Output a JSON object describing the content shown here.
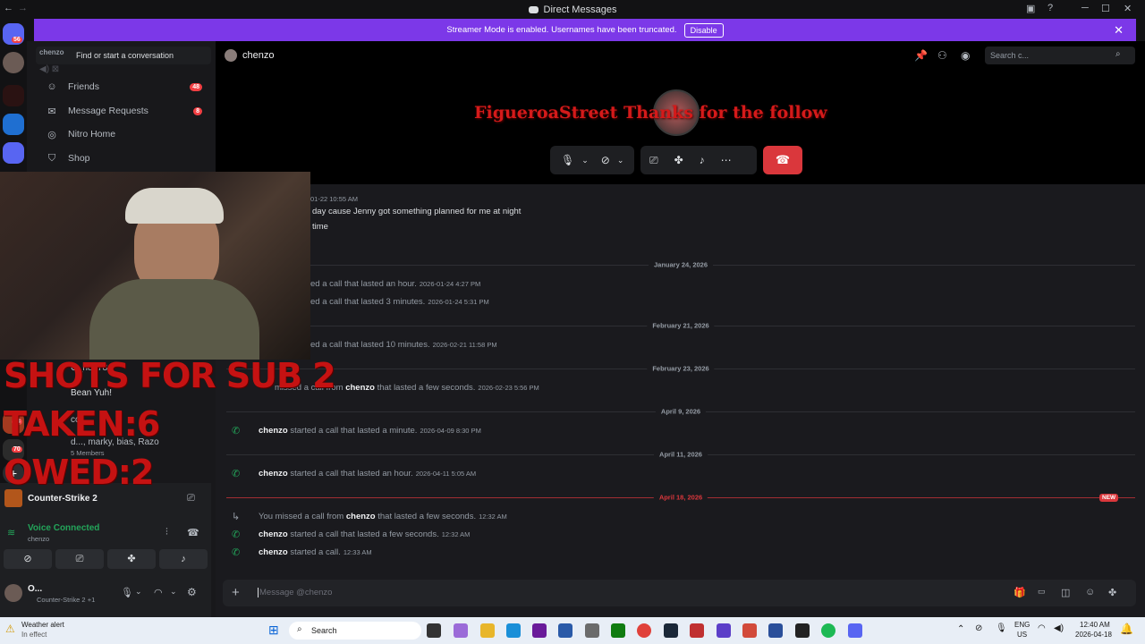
{
  "window": {
    "title": "Direct Messages"
  },
  "banner": {
    "text": "Streamer Mode is enabled. Usernames have been truncated.",
    "button": "Disable"
  },
  "rail": {
    "badges": [
      "56",
      "53",
      "70"
    ]
  },
  "sidebar": {
    "user_tag": "chenzo",
    "search_placeholder": "Find or start a conversation",
    "items": [
      {
        "label": "Friends",
        "badge": "48"
      },
      {
        "label": "Message Requests",
        "badge": "8"
      },
      {
        "label": "Nitro Home",
        "badge": ""
      },
      {
        "label": "Shop",
        "badge": ""
      }
    ],
    "dms": [
      {
        "name": "G_ne278"
      },
      {
        "name": "Bean Yuh!"
      },
      {
        "name": "coa"
      },
      {
        "name": "d..., marky, bias, Razo",
        "sub": "5 Members"
      }
    ]
  },
  "activity": {
    "game": "Counter-Strike 2"
  },
  "voice": {
    "status": "Voice Connected",
    "channel": "chenzo"
  },
  "user": {
    "name": "O...",
    "status": "Counter-Strike 2 +1"
  },
  "header": {
    "name": "chenzo",
    "search_placeholder": "Search c..."
  },
  "call": {
    "alert_text": "FigueroaStreet Thanks for the follow"
  },
  "overlay": {
    "line1": "SHOTS FOR SUB 2",
    "line2": "TAKEN:6",
    "line3": "OWED:2"
  },
  "messages": {
    "top_ts": "01-22 10:55 AM",
    "top_line1": "day cause Jenny got something planned for me at night",
    "top_line2": "time",
    "dates": [
      "January 24, 2026",
      "February 21, 2026",
      "February 23, 2026",
      "April 9, 2026",
      "April 11, 2026",
      "April 18, 2026"
    ],
    "new_label": "NEW",
    "rows": [
      {
        "pre": "",
        "name": "",
        "text": "ed a call that lasted an hour.",
        "ts": "2026-01-24 4:27 PM"
      },
      {
        "pre": "",
        "name": "",
        "text": "ed a call that lasted 3 minutes.",
        "ts": "2026-01-24 5:31 PM"
      },
      {
        "pre": "",
        "name": "",
        "text": "ed a call that lasted 10 minutes.",
        "ts": "2026-02-21 11:58 PM"
      },
      {
        "pre": "missed a call from",
        "name": "chenzo",
        "text": "that lasted a few seconds.",
        "ts": "2026-02-23 5:56 PM"
      },
      {
        "pre": "",
        "name": "chenzo",
        "text": "started a call that lasted a minute.",
        "ts": "2026-04-09 8:30 PM"
      },
      {
        "pre": "",
        "name": "chenzo",
        "text": "started a call that lasted an hour.",
        "ts": "2026-04-11 5:05 AM"
      },
      {
        "pre": "You missed a call from",
        "name": "chenzo",
        "text": "that lasted a few seconds.",
        "ts": "12:32 AM"
      },
      {
        "pre": "",
        "name": "chenzo",
        "text": "started a call that lasted a few seconds.",
        "ts": "12:32 AM"
      },
      {
        "pre": "",
        "name": "chenzo",
        "text": "started a call.",
        "ts": "12:33 AM"
      }
    ]
  },
  "composer": {
    "placeholder": "Message @chenzo"
  },
  "taskbar": {
    "weather_title": "Weather alert",
    "weather_sub": "In effect",
    "search": "Search",
    "lang1": "ENG",
    "lang2": "US",
    "time": "12:40 AM",
    "date": "2026-04-18"
  },
  "colors": {
    "accent": "#7c38e8",
    "danger": "#da373c",
    "online": "#23a55a",
    "overlay": "#c51212"
  }
}
